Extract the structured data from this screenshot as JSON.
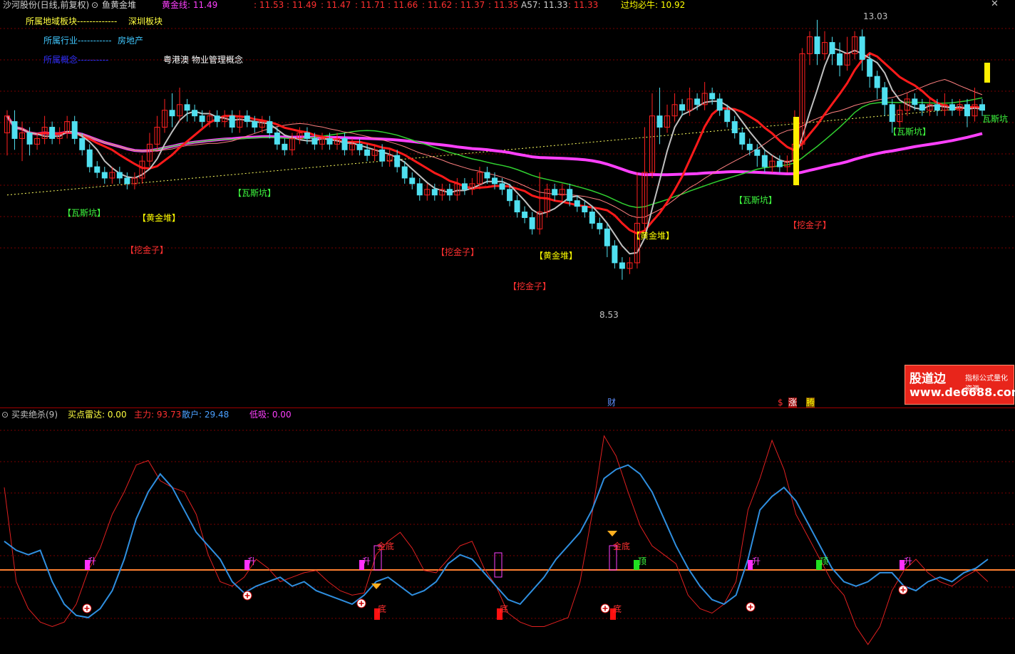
{
  "colors": {
    "up": "#ff2020",
    "down": "#50e0f0",
    "bg": "#000000",
    "grid": "#7a0000",
    "golden": "#ffff00",
    "magenta": "#ff40ff",
    "red_ma": "#ff1a1a",
    "blue": "#2040ff",
    "white": "#ffffff",
    "green": "#40ff40"
  },
  "header": {
    "stock": "沙河股份(日线,前复权)",
    "indicator": "鱼黄金堆",
    "huangjinxian": "黄金线: 11.49",
    "v1": ": 11.53",
    "v2": ": 11.49",
    "v3": ": 11.47",
    "v4": ": 11.71",
    "v5": ": 11.66",
    "v6": ": 11.62",
    "v7": ": 11.37",
    "v8": ": 11.35",
    "a57": "A57: 11.33",
    "v9": ": 11.33",
    "guojun": "过均必牛: 10.92"
  },
  "info": {
    "region_label": "所属地域板块-------------",
    "region_value": "深圳板块",
    "industry_label": "所属行业-----------",
    "industry_value": "房地产",
    "concept_label": "所属概念----------",
    "concept_value": "粤港澳 物业管理概念"
  },
  "annotations": {
    "wasikeng": "【瓦斯坑】",
    "huangjindui": "【黄金堆】",
    "wajinzi": "【挖金子】",
    "high": "13.03",
    "low": "8.53",
    "wasikeng_right": "瓦斯坑"
  },
  "markers": {
    "cai": "财",
    "dollar": "$",
    "zhang": "涨",
    "teng": "腾"
  },
  "sub_header": {
    "name": "买卖绝杀(9)",
    "buy_radar": "买点雷达: 0.00",
    "zhuli": "主力: 93.73",
    "sanhu": "散户: 29.48",
    "diji": "低吸: 0.00"
  },
  "sub_labels": {
    "sheng": "升",
    "jindi": "金底",
    "di": "底",
    "ding": "顶"
  },
  "watermark": {
    "name": "股道边",
    "slogan": "指标公式量化资源",
    "url": "www.de6688.com"
  },
  "chart_data": {
    "type": "candlestick",
    "main": {
      "ylim": [
        7.6,
        13.4
      ],
      "candles": [
        [
          11.2,
          11.5,
          10.8,
          11.6
        ],
        [
          11.4,
          11.1,
          10.9,
          11.6
        ],
        [
          11.1,
          11.2,
          10.7,
          11.4
        ],
        [
          11.2,
          11.0,
          10.8,
          11.3
        ],
        [
          11.0,
          11.1,
          10.9,
          11.2
        ],
        [
          11.1,
          11.3,
          11.0,
          11.5
        ],
        [
          11.3,
          11.1,
          11.0,
          11.4
        ],
        [
          11.1,
          11.2,
          11.0,
          11.3
        ],
        [
          11.2,
          11.4,
          11.1,
          11.5
        ],
        [
          11.4,
          11.1,
          11.0,
          11.5
        ],
        [
          11.1,
          10.9,
          10.8,
          11.2
        ],
        [
          10.9,
          10.6,
          10.5,
          11.0
        ],
        [
          10.6,
          10.5,
          10.4,
          10.7
        ],
        [
          10.5,
          10.4,
          10.3,
          10.6
        ],
        [
          10.4,
          10.5,
          10.3,
          10.6
        ],
        [
          10.5,
          10.4,
          10.3,
          10.6
        ],
        [
          10.4,
          10.3,
          10.2,
          10.5
        ],
        [
          10.3,
          10.4,
          10.2,
          10.5
        ],
        [
          10.4,
          10.7,
          10.3,
          10.8
        ],
        [
          10.7,
          11.0,
          10.6,
          11.2
        ],
        [
          11.0,
          11.3,
          10.9,
          11.5
        ],
        [
          11.3,
          11.6,
          11.2,
          11.8
        ],
        [
          11.6,
          11.5,
          11.3,
          11.9
        ],
        [
          11.5,
          11.7,
          11.4,
          12.0
        ],
        [
          11.7,
          11.6,
          11.4,
          11.8
        ],
        [
          11.6,
          11.5,
          11.4,
          11.7
        ],
        [
          11.5,
          11.4,
          11.3,
          11.6
        ],
        [
          11.4,
          11.5,
          11.3,
          11.6
        ],
        [
          11.5,
          11.4,
          11.3,
          11.6
        ],
        [
          11.4,
          11.5,
          11.3,
          11.6
        ],
        [
          11.5,
          11.3,
          11.2,
          11.6
        ],
        [
          11.3,
          11.5,
          11.2,
          11.6
        ],
        [
          11.5,
          11.4,
          11.3,
          11.6
        ],
        [
          11.4,
          11.3,
          11.2,
          11.5
        ],
        [
          11.3,
          11.4,
          11.2,
          11.5
        ],
        [
          11.4,
          11.2,
          11.1,
          11.5
        ],
        [
          11.2,
          11.0,
          10.9,
          11.3
        ],
        [
          11.0,
          10.9,
          10.8,
          11.1
        ],
        [
          10.9,
          11.1,
          10.8,
          11.2
        ],
        [
          11.1,
          11.2,
          11.0,
          11.3
        ],
        [
          11.2,
          11.1,
          11.0,
          11.3
        ],
        [
          11.1,
          11.0,
          10.9,
          11.2
        ],
        [
          11.0,
          11.1,
          10.9,
          11.2
        ],
        [
          11.1,
          11.0,
          10.9,
          11.2
        ],
        [
          11.0,
          11.1,
          10.9,
          11.2
        ],
        [
          11.1,
          10.9,
          10.8,
          11.2
        ],
        [
          10.9,
          11.0,
          10.8,
          11.1
        ],
        [
          11.0,
          10.9,
          10.8,
          11.1
        ],
        [
          10.9,
          10.8,
          10.7,
          11.0
        ],
        [
          10.8,
          10.9,
          10.7,
          11.0
        ],
        [
          10.9,
          10.7,
          10.6,
          11.0
        ],
        [
          10.7,
          10.8,
          10.6,
          10.9
        ],
        [
          10.8,
          10.6,
          10.5,
          10.9
        ],
        [
          10.6,
          10.4,
          10.3,
          10.7
        ],
        [
          10.4,
          10.3,
          10.2,
          10.5
        ],
        [
          10.3,
          10.1,
          10.0,
          10.4
        ],
        [
          10.1,
          10.2,
          10.0,
          10.3
        ],
        [
          10.2,
          10.1,
          10.0,
          10.3
        ],
        [
          10.1,
          10.2,
          10.0,
          10.3
        ],
        [
          10.2,
          10.1,
          10.0,
          10.3
        ],
        [
          10.1,
          10.3,
          10.0,
          10.4
        ],
        [
          10.3,
          10.2,
          10.1,
          10.4
        ],
        [
          10.2,
          10.3,
          10.1,
          10.4
        ],
        [
          10.3,
          10.5,
          10.2,
          10.6
        ],
        [
          10.5,
          10.4,
          10.3,
          10.6
        ],
        [
          10.4,
          10.3,
          10.2,
          10.5
        ],
        [
          10.3,
          10.2,
          10.1,
          10.4
        ],
        [
          10.2,
          10.0,
          9.9,
          10.3
        ],
        [
          10.0,
          9.8,
          9.7,
          10.1
        ],
        [
          9.8,
          9.7,
          9.6,
          9.9
        ],
        [
          9.7,
          9.5,
          9.4,
          9.8
        ],
        [
          9.5,
          9.8,
          9.4,
          10.5
        ],
        [
          9.8,
          10.2,
          9.7,
          10.3
        ],
        [
          10.2,
          10.1,
          10.0,
          10.3
        ],
        [
          10.1,
          10.2,
          10.0,
          10.3
        ],
        [
          10.2,
          10.0,
          9.9,
          10.3
        ],
        [
          10.0,
          9.9,
          9.8,
          10.1
        ],
        [
          9.9,
          9.8,
          9.7,
          10.0
        ],
        [
          9.8,
          9.6,
          9.5,
          9.9
        ],
        [
          9.6,
          9.5,
          9.4,
          9.7
        ],
        [
          9.5,
          9.2,
          9.0,
          9.6
        ],
        [
          9.2,
          8.9,
          8.8,
          9.3
        ],
        [
          8.9,
          8.8,
          8.6,
          9.0
        ],
        [
          8.8,
          8.9,
          8.7,
          9.0
        ],
        [
          8.9,
          9.6,
          8.8,
          10.5
        ],
        [
          9.6,
          10.5,
          9.5,
          11.3
        ],
        [
          10.5,
          11.5,
          10.4,
          11.9
        ],
        [
          11.5,
          11.3,
          11.0,
          12.0
        ],
        [
          11.3,
          11.5,
          11.2,
          11.7
        ],
        [
          11.5,
          11.7,
          11.4,
          11.9
        ],
        [
          11.7,
          11.6,
          11.5,
          11.8
        ],
        [
          11.6,
          11.8,
          11.5,
          12.0
        ],
        [
          11.8,
          11.7,
          11.6,
          11.9
        ],
        [
          11.7,
          11.9,
          11.6,
          12.1
        ],
        [
          11.9,
          11.8,
          11.7,
          12.0
        ],
        [
          11.8,
          11.6,
          11.5,
          11.9
        ],
        [
          11.6,
          11.4,
          11.3,
          11.7
        ],
        [
          11.4,
          11.2,
          11.1,
          11.5
        ],
        [
          11.2,
          11.0,
          10.9,
          11.3
        ],
        [
          11.0,
          10.9,
          10.8,
          11.1
        ],
        [
          10.9,
          10.8,
          10.6,
          11.0
        ],
        [
          10.8,
          10.6,
          10.5,
          10.9
        ],
        [
          10.6,
          10.7,
          10.5,
          10.8
        ],
        [
          10.7,
          10.6,
          10.5,
          10.8
        ],
        [
          10.6,
          10.7,
          10.5,
          10.8
        ],
        [
          10.7,
          11.0,
          10.6,
          11.6
        ],
        [
          11.0,
          12.6,
          10.9,
          12.7
        ],
        [
          12.6,
          12.9,
          12.4,
          13.0
        ],
        [
          12.9,
          12.6,
          12.4,
          13.2
        ],
        [
          12.6,
          12.8,
          12.5,
          13.0
        ],
        [
          12.8,
          12.6,
          12.4,
          12.9
        ],
        [
          12.6,
          12.4,
          12.2,
          12.8
        ],
        [
          12.4,
          12.6,
          12.3,
          12.9
        ],
        [
          12.6,
          12.9,
          12.5,
          13.0
        ],
        [
          12.9,
          12.5,
          12.3,
          13.03
        ],
        [
          12.5,
          12.2,
          12.0,
          12.6
        ],
        [
          12.2,
          12.0,
          11.8,
          12.3
        ],
        [
          12.0,
          11.7,
          11.5,
          12.1
        ],
        [
          11.7,
          11.4,
          11.2,
          11.8
        ],
        [
          11.4,
          11.6,
          11.3,
          11.7
        ],
        [
          11.6,
          11.8,
          11.5,
          11.9
        ],
        [
          11.8,
          11.7,
          11.6,
          11.9
        ],
        [
          11.7,
          11.6,
          11.5,
          11.8
        ],
        [
          11.6,
          11.7,
          11.5,
          11.8
        ],
        [
          11.7,
          11.6,
          11.5,
          11.8
        ],
        [
          11.6,
          11.7,
          11.5,
          11.9
        ],
        [
          11.7,
          11.6,
          11.5,
          11.8
        ],
        [
          11.6,
          11.7,
          11.5,
          11.8
        ],
        [
          11.7,
          11.5,
          11.3,
          11.8
        ],
        [
          11.5,
          11.7,
          11.4,
          12.0
        ],
        [
          11.7,
          11.6,
          11.5,
          11.8
        ]
      ]
    },
    "sub": {
      "ylim": [
        0,
        100
      ],
      "zhuli_red": [
        72,
        30,
        18,
        12,
        10,
        12,
        20,
        35,
        45,
        60,
        70,
        82,
        84,
        75,
        72,
        70,
        60,
        42,
        30,
        28,
        32,
        40,
        36,
        30,
        32,
        34,
        35,
        30,
        26,
        24,
        25,
        42,
        48,
        52,
        45,
        35,
        34,
        40,
        46,
        48,
        36,
        28,
        16,
        12,
        10,
        10,
        12,
        14,
        30,
        60,
        95,
        86,
        70,
        55,
        46,
        42,
        38,
        24,
        18,
        16,
        20,
        30,
        62,
        76,
        93,
        80,
        60,
        50,
        40,
        30,
        24,
        10,
        2,
        10,
        26,
        35,
        40,
        34,
        30,
        28,
        32,
        35,
        30
      ],
      "sanhu_blue": [
        48,
        44,
        42,
        44,
        30,
        20,
        15,
        14,
        18,
        26,
        40,
        58,
        70,
        78,
        72,
        62,
        52,
        46,
        40,
        30,
        25,
        28,
        30,
        32,
        28,
        30,
        26,
        24,
        22,
        20,
        24,
        30,
        32,
        28,
        24,
        26,
        30,
        38,
        42,
        40,
        34,
        28,
        22,
        20,
        26,
        32,
        40,
        46,
        52,
        62,
        76,
        80,
        82,
        78,
        70,
        58,
        46,
        36,
        28,
        22,
        20,
        24,
        40,
        62,
        68,
        72,
        66,
        56,
        46,
        36,
        30,
        28,
        30,
        34,
        34,
        28,
        26,
        30,
        32,
        30,
        34,
        36,
        40
      ]
    }
  }
}
